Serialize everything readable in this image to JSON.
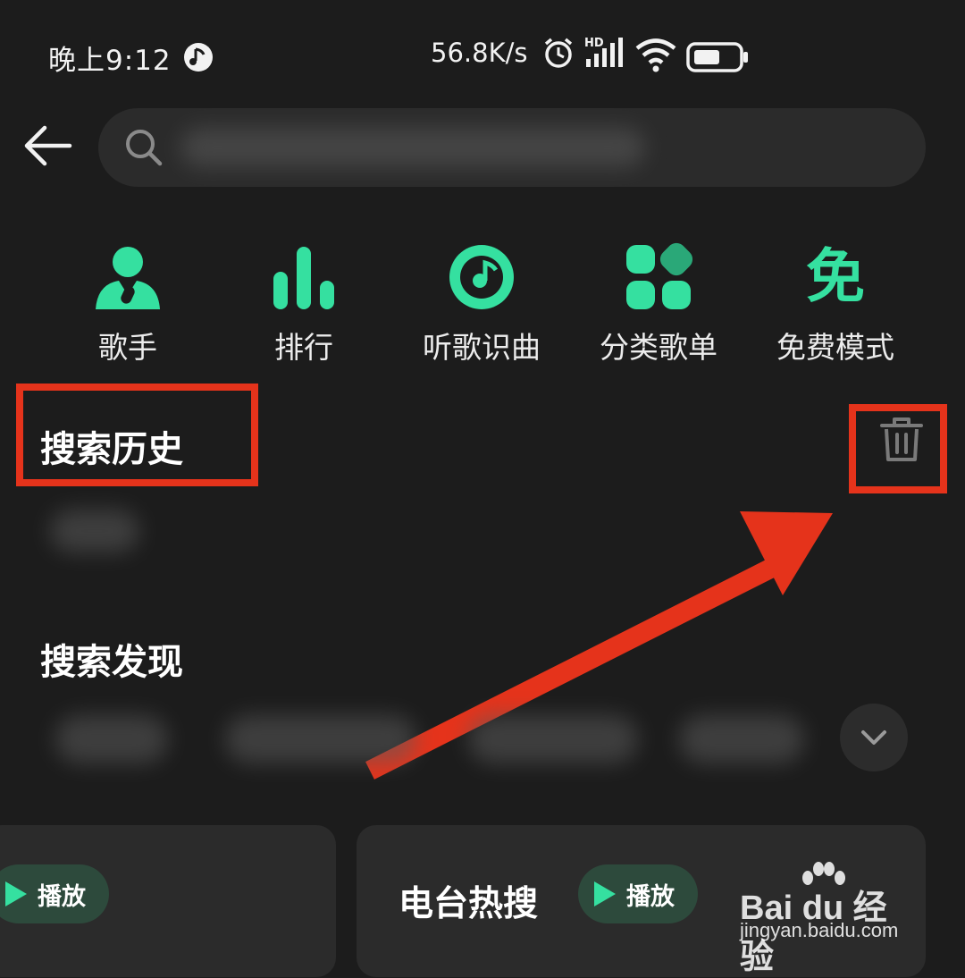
{
  "status_bar": {
    "time": "晚上9:12",
    "net_speed": "56.8K/s",
    "icons": [
      "music-indicator-icon",
      "alarm-icon",
      "hd-signal-icon",
      "wifi-icon",
      "battery-icon"
    ]
  },
  "search": {
    "placeholder": "",
    "icons": [
      "back-arrow-icon",
      "search-icon"
    ]
  },
  "quick_nav": [
    {
      "label": "歌手",
      "icon": "singer-icon"
    },
    {
      "label": "排行",
      "icon": "chart-bars-icon"
    },
    {
      "label": "听歌识曲",
      "icon": "music-recognition-icon"
    },
    {
      "label": "分类歌单",
      "icon": "category-grid-icon"
    },
    {
      "label": "免费模式",
      "icon": "free-mode-icon",
      "glyph": "免"
    }
  ],
  "history": {
    "title": "搜索历史",
    "clear_icon": "trash-icon"
  },
  "discover": {
    "title": "搜索发现",
    "expand_icon": "chevron-down-icon"
  },
  "cards": [
    {
      "title": "",
      "play_label": "播放"
    },
    {
      "title": "电台热搜",
      "play_label": "播放"
    }
  ],
  "watermark": {
    "brand": "Bai du 经验",
    "url": "jingyan.baidu.com"
  },
  "colors": {
    "accent": "#35e0a0",
    "annotation_red": "#e5331b",
    "background": "#1c1c1c"
  }
}
